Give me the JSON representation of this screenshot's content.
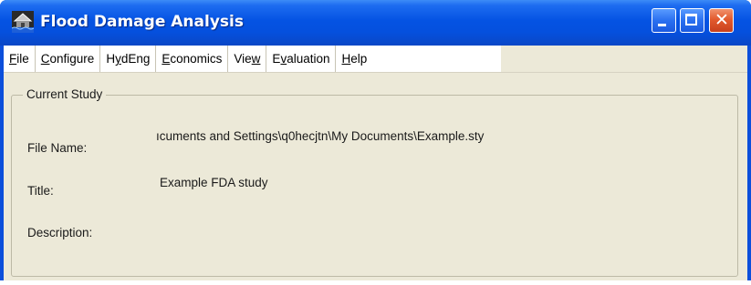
{
  "window": {
    "title": "Flood Damage Analysis"
  },
  "menu": {
    "file": {
      "pre": "",
      "u": "F",
      "post": "ile"
    },
    "configure": {
      "pre": "",
      "u": "C",
      "post": "onfigure"
    },
    "hydeng": {
      "pre": "H",
      "u": "y",
      "post": "dEng"
    },
    "economics": {
      "pre": "",
      "u": "E",
      "post": "conomics"
    },
    "view": {
      "pre": "Vie",
      "u": "w",
      "post": ""
    },
    "evaluation": {
      "pre": "E",
      "u": "v",
      "post": "aluation"
    },
    "help": {
      "pre": "",
      "u": "H",
      "post": "elp"
    }
  },
  "study": {
    "group_label": "Current Study",
    "file_name_label": "File Name:",
    "file_name_value": "ıcuments and Settings\\q0hecjtn\\My Documents\\Example.sty",
    "title_label": "Title:",
    "title_value": "Example FDA study",
    "description_label": "Description:",
    "description_value": ""
  },
  "colors": {
    "titlebar": "#0553e3",
    "client_bg": "#ece9d8",
    "close_button": "#e35b2e"
  }
}
